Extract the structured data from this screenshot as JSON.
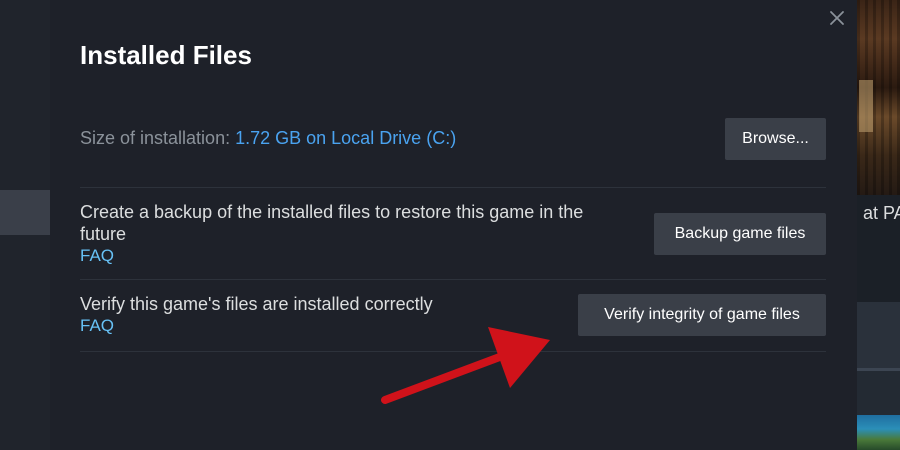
{
  "dialog": {
    "title": "Installed Files",
    "close_icon": "close-icon"
  },
  "size": {
    "label": "Size of installation: ",
    "value": "1.72 GB on Local Drive (C:)",
    "browse_label": "Browse..."
  },
  "backup": {
    "description": "Create a backup of the installed files to restore this game in the future",
    "faq_label": "FAQ",
    "button_label": "Backup game files"
  },
  "verify": {
    "description": "Verify this game's files are installed correctly",
    "faq_label": "FAQ",
    "button_label": "Verify integrity of game files"
  },
  "background": {
    "right_text": "at PA"
  },
  "annotation": {
    "arrow_color": "#d0121a"
  },
  "colors": {
    "link": "#4aa3f0",
    "faq": "#67c1f5",
    "button_bg": "#3a3f48",
    "dialog_bg": "#1e2129"
  }
}
